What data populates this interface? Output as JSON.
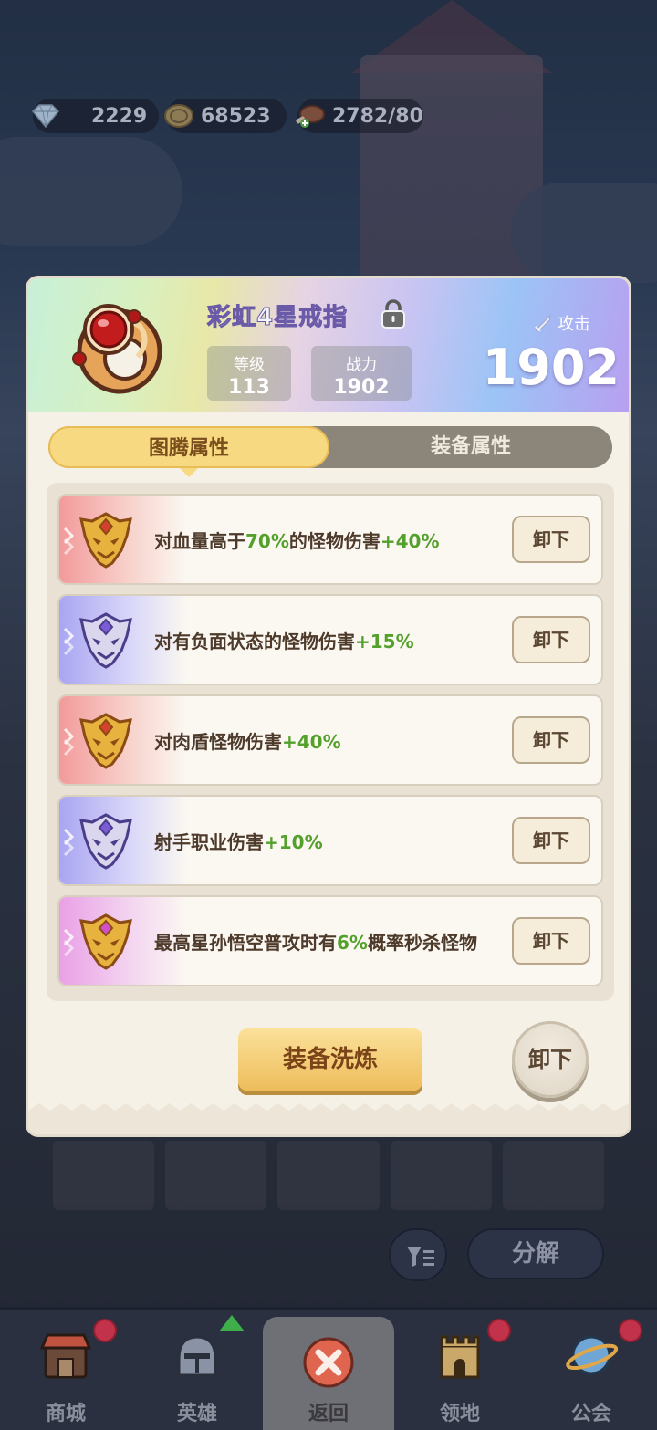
{
  "resources": {
    "diamonds": "2229",
    "coins": "68523",
    "stamina": "2782/80"
  },
  "item": {
    "name": "彩虹4星戒指",
    "level_label": "等级",
    "level_value": "113",
    "power_label": "战力",
    "power_value": "1902",
    "attack_label": "攻击",
    "attack_value": "1902"
  },
  "tabs": {
    "active": "图腾属性",
    "inactive": "装备属性"
  },
  "attributes": [
    {
      "pre": "对血量高于",
      "hl1": "70%",
      "mid": "的怪物伤害",
      "hl2": "+40%",
      "post": "",
      "rarity": "red",
      "button": "卸下"
    },
    {
      "pre": "对有负面状态的怪物伤害",
      "hl1": "",
      "mid": "",
      "hl2": "+15%",
      "post": "",
      "rarity": "purple",
      "button": "卸下"
    },
    {
      "pre": "对肉盾怪物伤害",
      "hl1": "",
      "mid": "",
      "hl2": "+40%",
      "post": "",
      "rarity": "red",
      "button": "卸下"
    },
    {
      "pre": "射手职业伤害",
      "hl1": "",
      "mid": "",
      "hl2": "+10%",
      "post": "",
      "rarity": "purple",
      "button": "卸下"
    },
    {
      "pre": "最高星孙悟空普攻时有",
      "hl1": "6%",
      "mid": "概率秒杀怪物",
      "hl2": "",
      "post": "",
      "rarity": "pink",
      "button": "卸下"
    }
  ],
  "actions": {
    "refine": "装备洗炼",
    "unequip": "卸下"
  },
  "background": {
    "decompose": "分解"
  },
  "nav": [
    {
      "label": "商城",
      "icon": "shop-icon",
      "dot": true
    },
    {
      "label": "英雄",
      "icon": "hero-helmet-icon",
      "dot": false
    },
    {
      "label": "返回",
      "icon": "close-icon",
      "dot": false
    },
    {
      "label": "领地",
      "icon": "castle-icon",
      "dot": true
    },
    {
      "label": "公会",
      "icon": "planet-icon",
      "dot": true
    }
  ],
  "colors": {
    "highlight": "#54a02c",
    "text_brown": "#4d3a2b",
    "tab_active": "#f7d982",
    "red_dot": "#c2324a"
  }
}
